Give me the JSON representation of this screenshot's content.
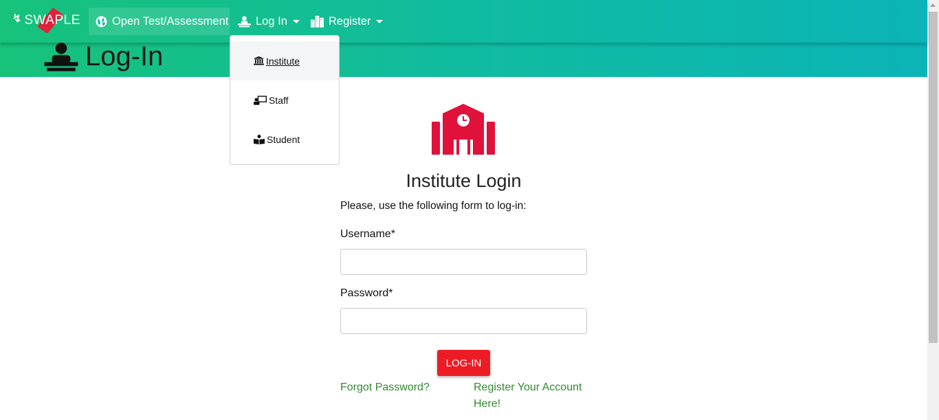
{
  "navbar": {
    "brand": "SWAPLE",
    "items": [
      {
        "label": "Open Test/Assessment",
        "icon": "globe-icon"
      },
      {
        "label": "Log In",
        "icon": "user-desk-icon"
      },
      {
        "label": "Register",
        "icon": "building-icon"
      }
    ]
  },
  "page": {
    "title": "Log-In"
  },
  "dropdown": {
    "items": [
      {
        "label": "Institute",
        "icon": "university-icon"
      },
      {
        "label": "Staff",
        "icon": "chalkboard-teacher-icon"
      },
      {
        "label": "Student",
        "icon": "book-reader-icon"
      }
    ]
  },
  "form": {
    "title": "Institute Login",
    "instruction": "Please, use the following form to log-in:",
    "username_label": "Username*",
    "password_label": "Password*",
    "submit_label": "LOG-IN",
    "forgot_link": "Forgot Password?",
    "register_link": "Register Your Account Here!"
  },
  "colors": {
    "gradient_start": "#17c27a",
    "gradient_end": "#0bb4b6",
    "accent_red": "#ed1c24",
    "link_green": "#2e8b2e",
    "icon_red": "#e0113a"
  }
}
